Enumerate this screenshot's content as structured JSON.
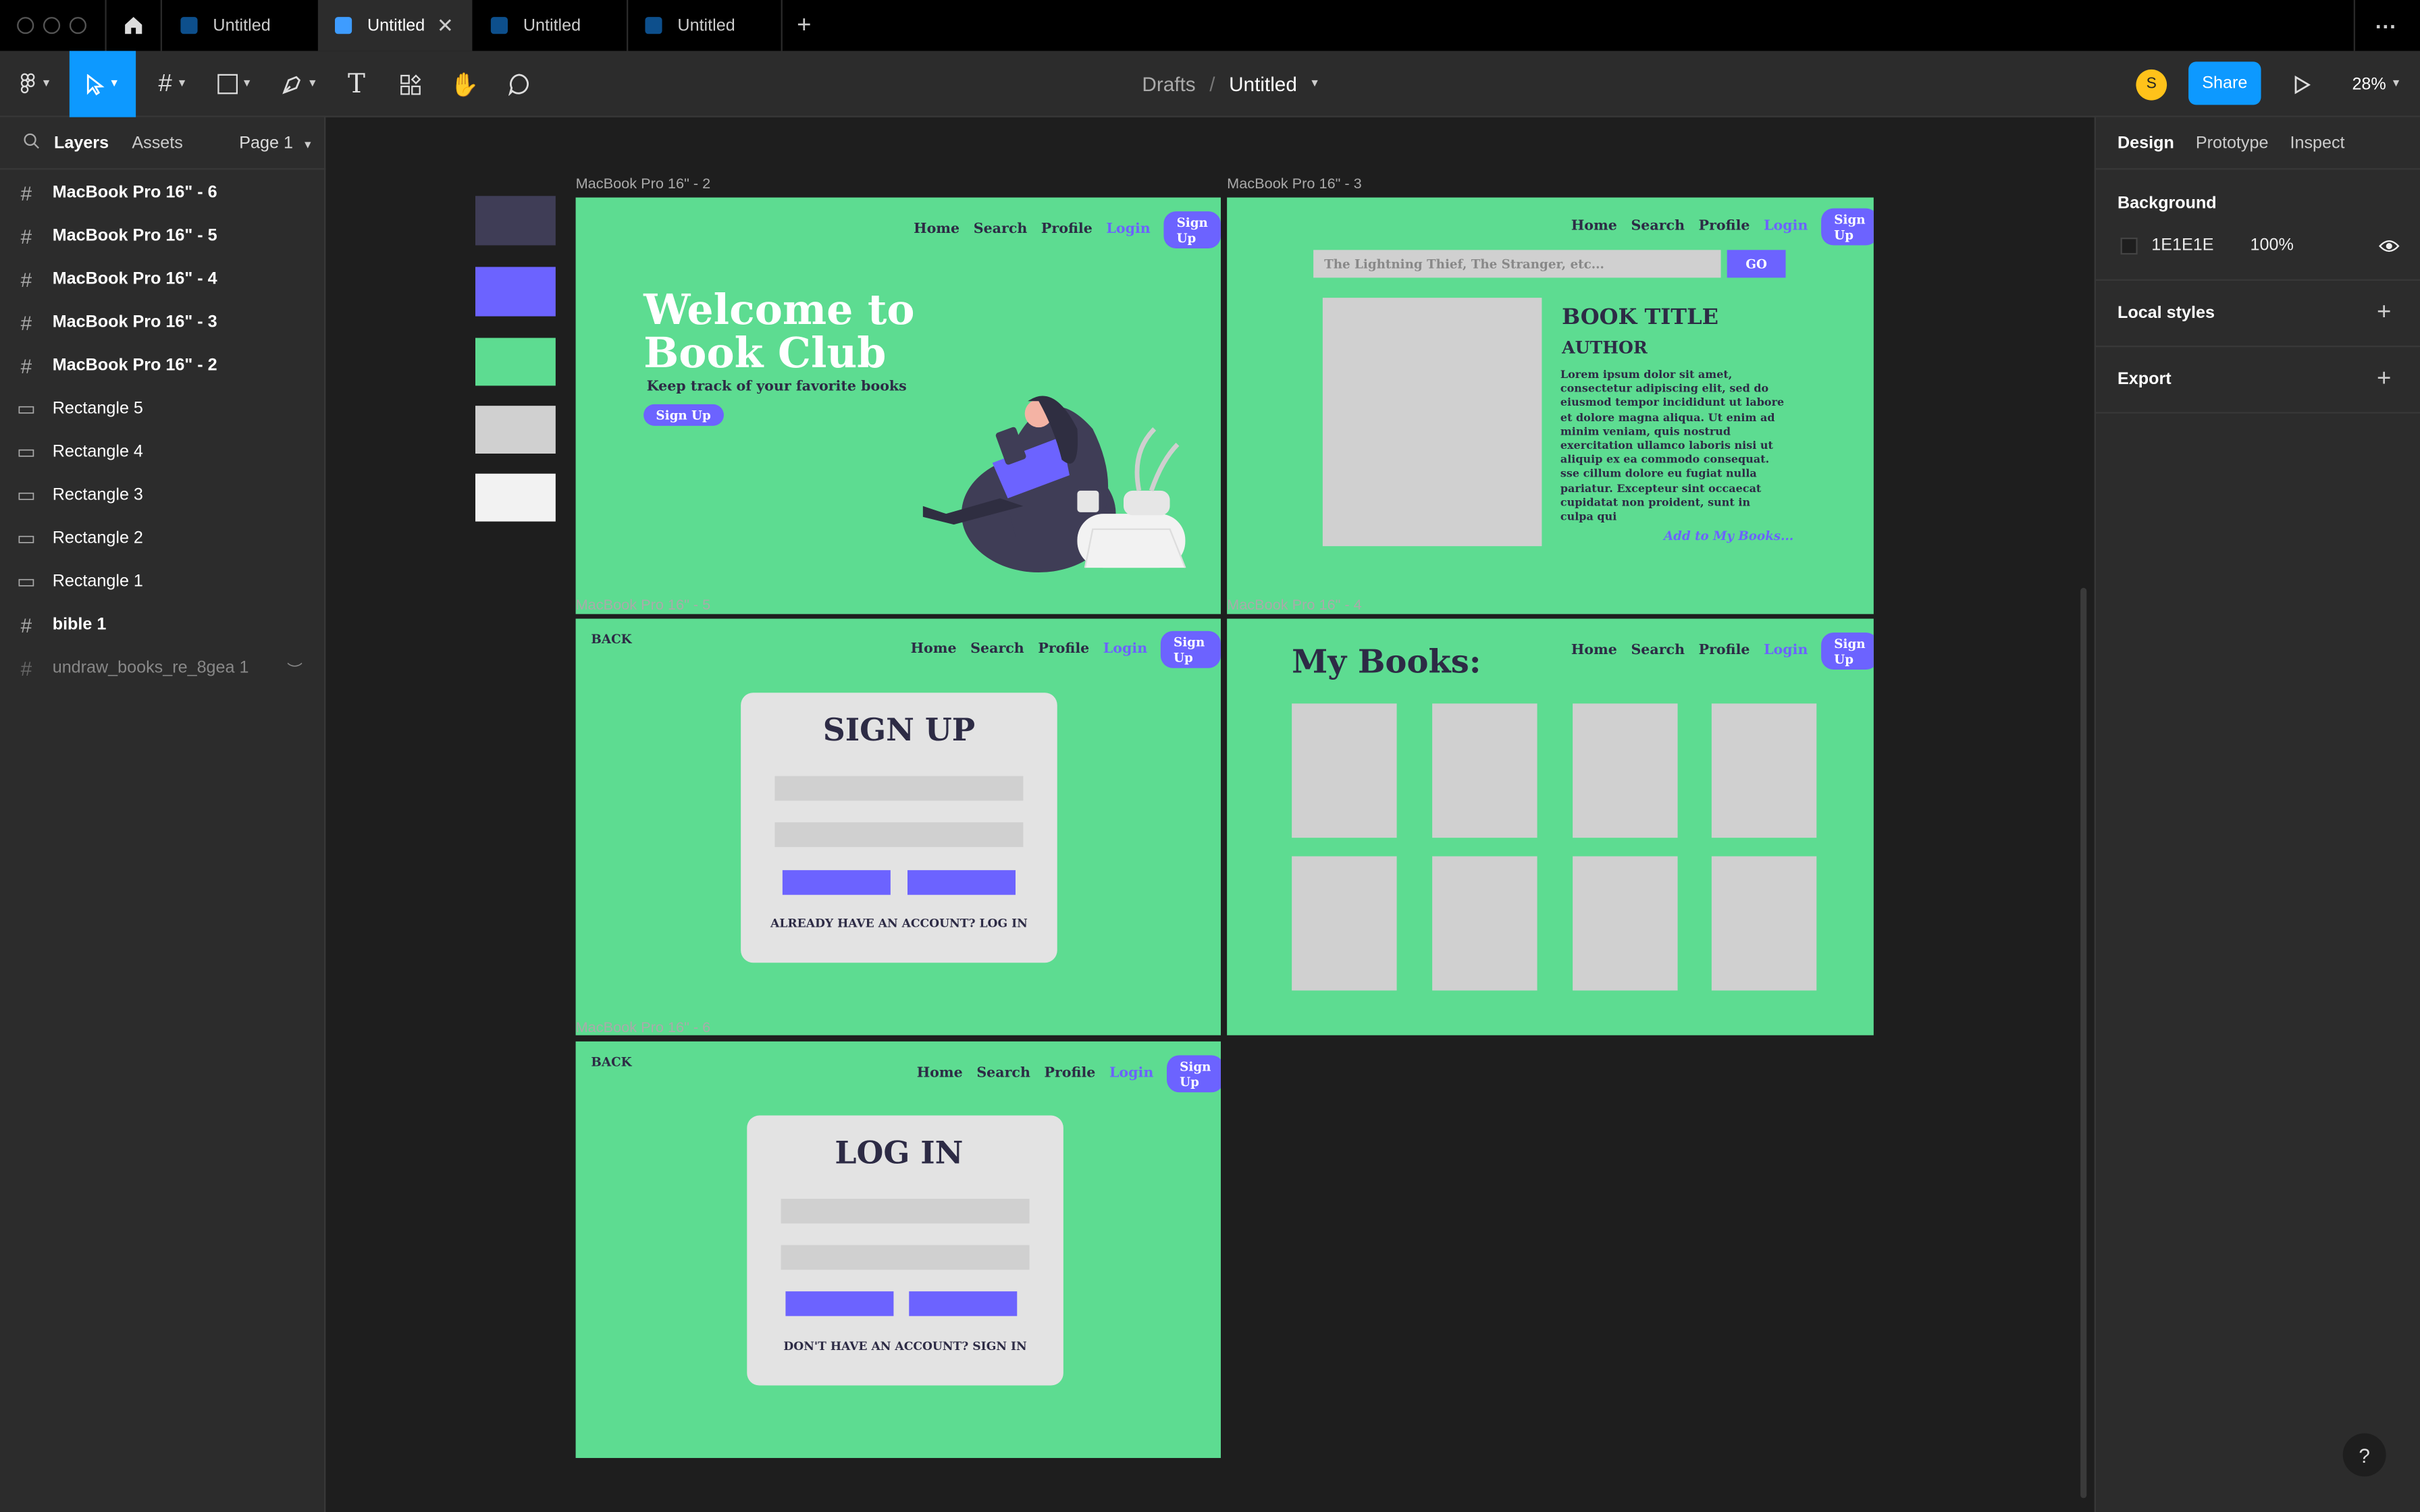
{
  "tabs": {
    "home_icon": "home-icon",
    "items": [
      {
        "label": "Untitled"
      },
      {
        "label": "Untitled",
        "active": true
      },
      {
        "label": "Untitled"
      },
      {
        "label": "Untitled"
      }
    ],
    "new_tab": "+",
    "more": "···"
  },
  "toolbar": {
    "breadcrumb_parent": "Drafts",
    "breadcrumb_sep": "/",
    "file_name": "Untitled",
    "avatar_initial": "S",
    "share_label": "Share",
    "zoom": "28%"
  },
  "left_panel": {
    "tab_layers": "Layers",
    "tab_assets": "Assets",
    "page": "Page 1",
    "layers": [
      {
        "name": "MacBook Pro 16\" - 6",
        "type": "frame"
      },
      {
        "name": "MacBook Pro 16\" - 5",
        "type": "frame"
      },
      {
        "name": "MacBook Pro 16\" - 4",
        "type": "frame"
      },
      {
        "name": "MacBook Pro 16\" - 3",
        "type": "frame"
      },
      {
        "name": "MacBook Pro 16\" - 2",
        "type": "frame"
      },
      {
        "name": "Rectangle 5",
        "type": "rect"
      },
      {
        "name": "Rectangle 4",
        "type": "rect"
      },
      {
        "name": "Rectangle 3",
        "type": "rect"
      },
      {
        "name": "Rectangle 2",
        "type": "rect"
      },
      {
        "name": "Rectangle 1",
        "type": "rect"
      },
      {
        "name": "bible 1",
        "type": "frame"
      },
      {
        "name": "undraw_books_re_8gea 1",
        "type": "frame-hidden"
      }
    ]
  },
  "canvas": {
    "swatches": [
      "#3f3d56",
      "#6c63ff",
      "#5ddc91",
      "#d0d0d0",
      "#f2f2f2"
    ],
    "frame_labels": {
      "f2": "MacBook Pro 16\" - 2",
      "f3": "MacBook Pro 16\" - 3",
      "f5": "MacBook Pro 16\" - 5",
      "f4": "MacBook Pro 16\" - 4",
      "f6": "MacBook Pro 16\" - 6"
    },
    "nav": {
      "home": "Home",
      "search": "Search",
      "profile": "Profile",
      "login": "Login",
      "signup": "Sign Up"
    },
    "back": "BACK",
    "welcome": {
      "title_line1": "Welcome to",
      "title_line2": "Book Club",
      "subtitle": "Keep track of your favorite books",
      "cta": "Sign Up"
    },
    "book": {
      "search_placeholder": "The Lightning Thief, The Stranger, etc...",
      "go": "GO",
      "title": "BOOK TITLE",
      "author": "AUTHOR",
      "description": "Lorem ipsum dolor sit amet, consectetur adipiscing elit, sed do eiusmod tempor incididunt ut labore et dolore magna aliqua. Ut enim ad minim veniam, quis nostrud exercitation ullamco laboris nisi ut aliquip ex ea commodo consequat. sse cillum dolore eu fugiat nulla pariatur. Excepteur sint occaecat cupidatat non proident, sunt in culpa qui",
      "add_link": "Add to My Books..."
    },
    "mybooks": {
      "heading": "My Books:"
    },
    "signup": {
      "heading": "SIGN UP",
      "footer": "ALREADY HAVE AN ACCOUNT? LOG IN"
    },
    "login": {
      "heading": "LOG IN",
      "footer": "DON'T HAVE AN ACCOUNT? SIGN IN"
    }
  },
  "right_panel": {
    "tab_design": "Design",
    "tab_prototype": "Prototype",
    "tab_inspect": "Inspect",
    "background_label": "Background",
    "bg_hex": "1E1E1E",
    "bg_opacity": "100%",
    "local_styles": "Local styles",
    "export": "Export",
    "help": "?"
  }
}
